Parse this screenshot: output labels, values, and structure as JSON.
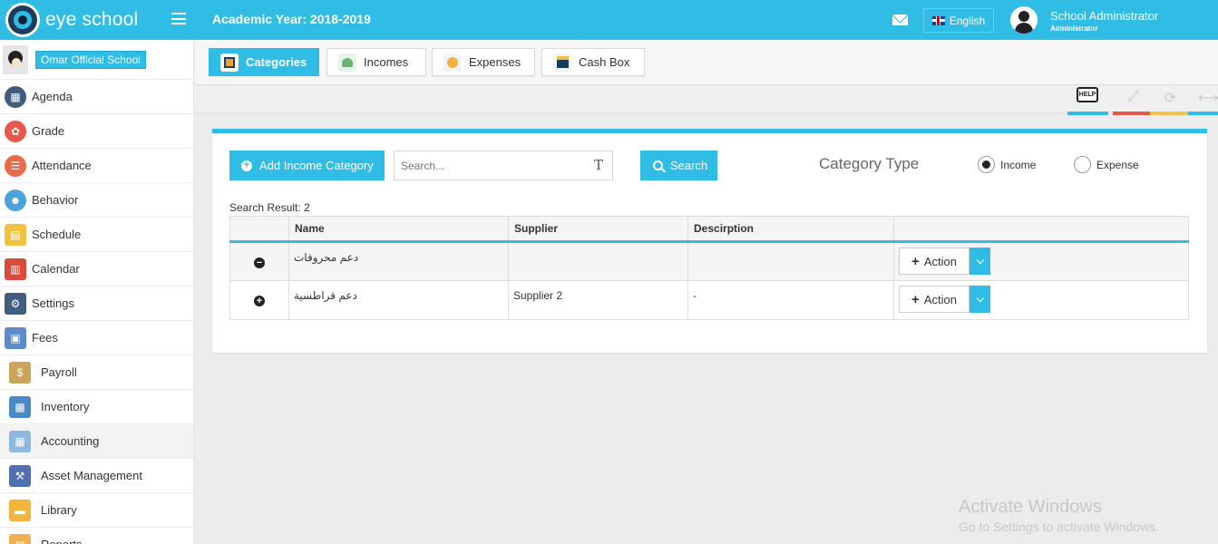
{
  "header": {
    "app_name": "eye school",
    "academic_year": "Academic Year: 2018-2019",
    "language": "English",
    "user_name": "School Administrator",
    "user_role": "Administrator",
    "brand_color": "#2fbde6"
  },
  "sidebar": {
    "school_name": "Omar Official School",
    "items": [
      {
        "label": "Agenda",
        "icon": "agenda-icon",
        "color": "#3f5d7d"
      },
      {
        "label": "Grade",
        "icon": "grade-icon",
        "color": "#e9574a"
      },
      {
        "label": "Attendance",
        "icon": "attendance-icon",
        "color": "#e96a48"
      },
      {
        "label": "Behavior",
        "icon": "behavior-icon",
        "color": "#4ba3d9"
      },
      {
        "label": "Schedule",
        "icon": "schedule-icon",
        "color": "#f0c040"
      },
      {
        "label": "Calendar",
        "icon": "calendar-icon",
        "color": "#d94a3a"
      },
      {
        "label": "Settings",
        "icon": "settings-icon",
        "color": "#3f5d7d"
      },
      {
        "label": "Fees",
        "icon": "fees-icon",
        "color": "#5b8cc7"
      },
      {
        "label": "Payroll",
        "icon": "payroll-icon",
        "color": "#c9a45a"
      },
      {
        "label": "Inventory",
        "icon": "inventory-icon",
        "color": "#4a87c5"
      },
      {
        "label": "Accounting",
        "icon": "accounting-icon",
        "color": "#8fb8e0"
      },
      {
        "label": "Asset Management",
        "icon": "asset-management-icon",
        "color": "#4f6fb0"
      },
      {
        "label": "Library",
        "icon": "library-icon",
        "color": "#f2b63d"
      },
      {
        "label": "Reports",
        "icon": "reports-icon",
        "color": "#f0b050"
      }
    ]
  },
  "tabs": [
    {
      "label": "Categories",
      "icon": "categories-icon",
      "active": true
    },
    {
      "label": "Incomes",
      "icon": "incomes-icon",
      "active": false
    },
    {
      "label": "Expenses",
      "icon": "expenses-icon",
      "active": false
    },
    {
      "label": "Cash Box",
      "icon": "cash-box-icon",
      "active": false
    }
  ],
  "tools": {
    "help_label": "HELP",
    "colors": [
      "#2fbde6",
      "#e9574a",
      "#f2c14e",
      "#2fbde6"
    ]
  },
  "panel": {
    "add_button": "Add Income Category",
    "search_placeholder": "Search...",
    "search_button": "Search",
    "category_type_label": "Category Type",
    "radio_income": "Income",
    "radio_expense": "Expense",
    "selected_type": "Income",
    "result_text": "Search Result: 2",
    "columns": [
      "Name",
      "Supplier",
      "Descirption"
    ],
    "rows": [
      {
        "toggle": "minus",
        "name": "دعم محروقات",
        "supplier": "",
        "description": "",
        "action": "Action"
      },
      {
        "toggle": "plus",
        "name": "دعم قراطسية",
        "supplier": "Supplier 2",
        "description": "-",
        "action": "Action"
      }
    ]
  },
  "watermark": {
    "title": "Activate Windows",
    "subtitle": "Go to Settings to activate Windows."
  }
}
